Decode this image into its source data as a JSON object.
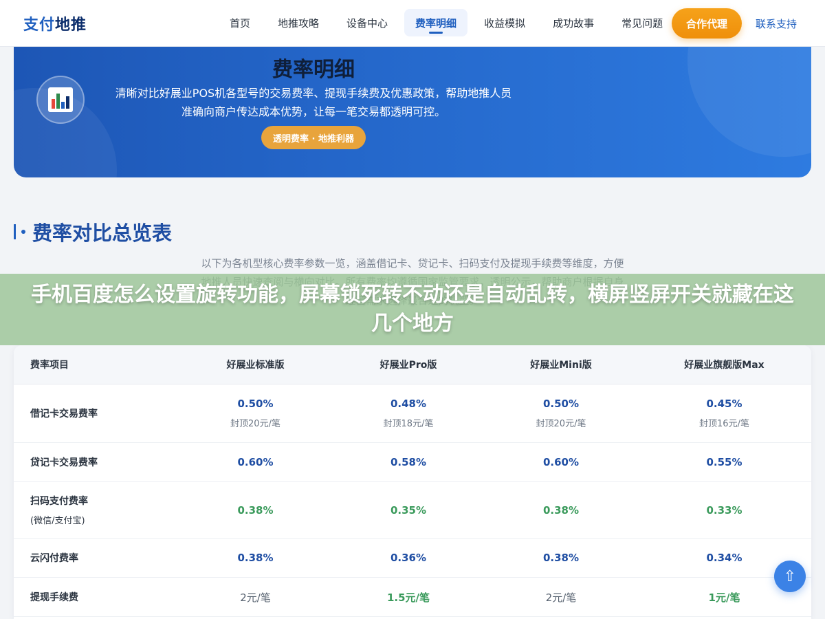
{
  "header": {
    "logo_part1": "支付",
    "logo_part2": "地推",
    "nav": [
      "首页",
      "地推攻略",
      "设备中心",
      "费率明细",
      "收益模拟",
      "成功故事",
      "常见问题"
    ],
    "active_index": 3,
    "cta": "合作代理",
    "support": "联系支持"
  },
  "hero": {
    "title": "费率明细",
    "desc": "清晰对比好展业POS机各型号的交易费率、提现手续费及优惠政策，帮助地推人员准确向商户传达成本优势，让每一笔交易都透明可控。",
    "badge": "透明费率 · 地推利器",
    "icon": "bar-chart-icon"
  },
  "section": {
    "title": "费率对比总览表",
    "intro": "以下为各机型核心费率参数一览，涵盖借记卡、贷记卡、扫码支付及提现手续费等维度，方便地推人员快速查阅与横向对比。所有费率均遵循国家监管要求，透明公示，帮助商户根据自身经营需求选择最合适的机型。"
  },
  "banner": {
    "text": "手机百度怎么设置旋转功能，屏幕锁死转不动还是自动乱转，横屏竖屏开关就藏在这几个地方"
  },
  "table": {
    "headers": [
      "费率项目",
      "好展业标准版",
      "好展业Pro版",
      "好展业Mini版",
      "好展业旗舰版Max"
    ],
    "rows": [
      {
        "label": "借记卡交易费率",
        "sub": "",
        "values": [
          "0.50%",
          "0.48%",
          "0.50%",
          "0.45%"
        ],
        "caps": [
          "封顶20元/笔",
          "封顶18元/笔",
          "封顶20元/笔",
          "封顶16元/笔"
        ],
        "style": [
          "blue",
          "blue",
          "blue",
          "blue"
        ]
      },
      {
        "label": "贷记卡交易费率",
        "sub": "",
        "values": [
          "0.60%",
          "0.58%",
          "0.60%",
          "0.55%"
        ],
        "caps": [
          "",
          "",
          "",
          ""
        ],
        "style": [
          "blue",
          "blue",
          "blue",
          "blue"
        ]
      },
      {
        "label": "扫码支付费率",
        "sub": "(微信/支付宝)",
        "values": [
          "0.38%",
          "0.35%",
          "0.38%",
          "0.33%"
        ],
        "caps": [
          "",
          "",
          "",
          ""
        ],
        "style": [
          "green",
          "green",
          "green",
          "green"
        ]
      },
      {
        "label": "云闪付费率",
        "sub": "",
        "values": [
          "0.38%",
          "0.36%",
          "0.38%",
          "0.34%"
        ],
        "caps": [
          "",
          "",
          "",
          ""
        ],
        "style": [
          "blue",
          "blue",
          "blue",
          "blue"
        ]
      },
      {
        "label": "提现手续费",
        "sub": "",
        "values": [
          "2元/笔",
          "1.5元/笔",
          "2元/笔",
          "1元/笔"
        ],
        "caps": [
          "",
          "",
          "",
          ""
        ],
        "style": [
          "plain",
          "green",
          "plain",
          "green"
        ]
      }
    ]
  },
  "fab": {
    "icon": "arrow-up-icon",
    "glyph": "⇧"
  },
  "colors": {
    "primary": "#1f5fbf",
    "accent": "#ef8f0a",
    "green": "#3a9a5b"
  }
}
